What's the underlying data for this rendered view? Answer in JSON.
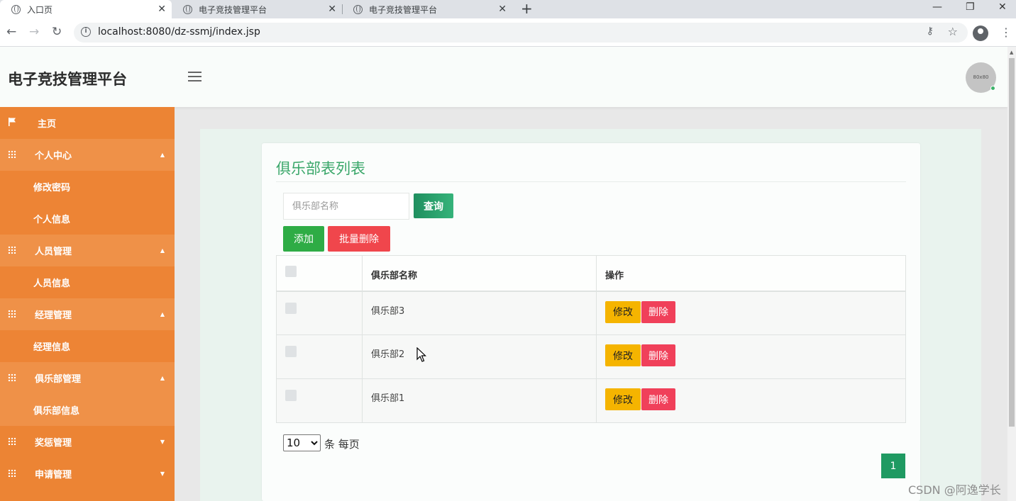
{
  "browser": {
    "tabs": [
      {
        "title": "入口页"
      },
      {
        "title": "电子竞技管理平台"
      },
      {
        "title": "电子竞技管理平台"
      }
    ],
    "url": "localhost:8080/dz-ssmj/index.jsp",
    "controls": {
      "new_tab": "+",
      "close": "✕",
      "minimize": "—",
      "restore": "❐",
      "window_close": "✕"
    }
  },
  "header": {
    "app_title": "电子竞技管理平台",
    "avatar_text": "80x80"
  },
  "sidebar": {
    "items": [
      {
        "label": "主页",
        "type": "home",
        "icon": "flag-icon"
      },
      {
        "label": "个人中心",
        "type": "group",
        "icon": "grid-icon",
        "expanded": true
      },
      {
        "label": "修改密码",
        "type": "sub"
      },
      {
        "label": "个人信息",
        "type": "sub"
      },
      {
        "label": "人员管理",
        "type": "group",
        "icon": "grid-icon",
        "expanded": true
      },
      {
        "label": "人员信息",
        "type": "sub"
      },
      {
        "label": "经理管理",
        "type": "group",
        "icon": "grid-icon",
        "expanded": true
      },
      {
        "label": "经理信息",
        "type": "sub"
      },
      {
        "label": "俱乐部管理",
        "type": "group",
        "icon": "grid-icon",
        "expanded": true
      },
      {
        "label": "俱乐部信息",
        "type": "sub"
      },
      {
        "label": "奖惩管理",
        "type": "group",
        "icon": "grid-icon",
        "expanded": false
      },
      {
        "label": "申请管理",
        "type": "group",
        "icon": "grid-icon",
        "expanded": false
      }
    ]
  },
  "main": {
    "title": "俱乐部表列表",
    "search": {
      "placeholder": "俱乐部名称",
      "value": ""
    },
    "buttons": {
      "query": "查询",
      "add": "添加",
      "batch_delete": "批量删除"
    },
    "table": {
      "columns": [
        "",
        "俱乐部名称",
        "操作"
      ],
      "rows": [
        {
          "name": "俱乐部3",
          "edit": "修改",
          "delete": "删除"
        },
        {
          "name": "俱乐部2",
          "edit": "修改",
          "delete": "删除"
        },
        {
          "name": "俱乐部1",
          "edit": "修改",
          "delete": "删除"
        }
      ]
    },
    "pagination": {
      "page_size": "10",
      "page_size_label": "条 每页",
      "current_page": "1"
    }
  },
  "watermark": "CSDN @阿逸学长",
  "colors": {
    "sidebar": "#ec8434",
    "accent_green": "#3aa76a",
    "add_button": "#2eac45",
    "delete_button": "#f0405a",
    "edit_button": "#f5b400"
  }
}
